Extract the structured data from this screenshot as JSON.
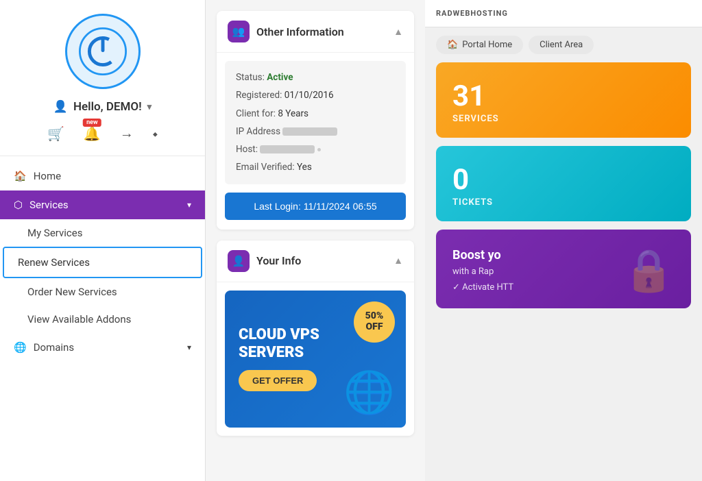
{
  "sidebar": {
    "greeting": "Hello, DEMO!",
    "new_badge": "new",
    "nav": [
      {
        "id": "home",
        "label": "Home",
        "icon": "🏠"
      },
      {
        "id": "services",
        "label": "Services",
        "icon": "⬡",
        "active": true,
        "expanded": true
      },
      {
        "id": "my-services",
        "label": "My Services",
        "sub": true
      },
      {
        "id": "renew-services",
        "label": "Renew Services",
        "sub": true,
        "active_page": true
      },
      {
        "id": "order-new",
        "label": "Order New Services",
        "sub": true
      },
      {
        "id": "addons",
        "label": "View Available Addons",
        "sub": true
      },
      {
        "id": "domains",
        "label": "Domains",
        "icon": "🌐",
        "expandable": true
      }
    ]
  },
  "other_info": {
    "title": "Other Information",
    "status_label": "Status:",
    "status_value": "Active",
    "registered_label": "Registered:",
    "registered_value": "01/10/2016",
    "client_for_label": "Client for:",
    "client_for_value": "8 Years",
    "ip_label": "IP Address",
    "host_label": "Host:",
    "email_label": "Email Verified:",
    "email_value": "Yes",
    "last_login_label": "Last Login:",
    "last_login_value": "11/11/2024 06:55",
    "last_login_btn": "Last Login: 11/11/2024 06:55"
  },
  "your_info": {
    "title": "Your Info",
    "promo": {
      "title_line1": "CLOUD VPS",
      "title_line2": "SERVERS",
      "badge_pct": "50%",
      "badge_text": "OFF",
      "cta": "GET OFFER"
    }
  },
  "right_panel": {
    "logo": "RADWEBHOSTING",
    "breadcrumbs": [
      {
        "label": "Portal Home",
        "icon": "🏠"
      },
      {
        "label": "Client Area"
      }
    ],
    "stats": [
      {
        "id": "services",
        "number": "31",
        "label": "SERVICES",
        "color": "services"
      },
      {
        "id": "tickets",
        "number": "0",
        "label": "TICKETS",
        "color": "tickets"
      }
    ],
    "boost": {
      "title": "Boost yo",
      "subtitle": "with a Rap",
      "cta": "✓ Activate HTT"
    }
  }
}
